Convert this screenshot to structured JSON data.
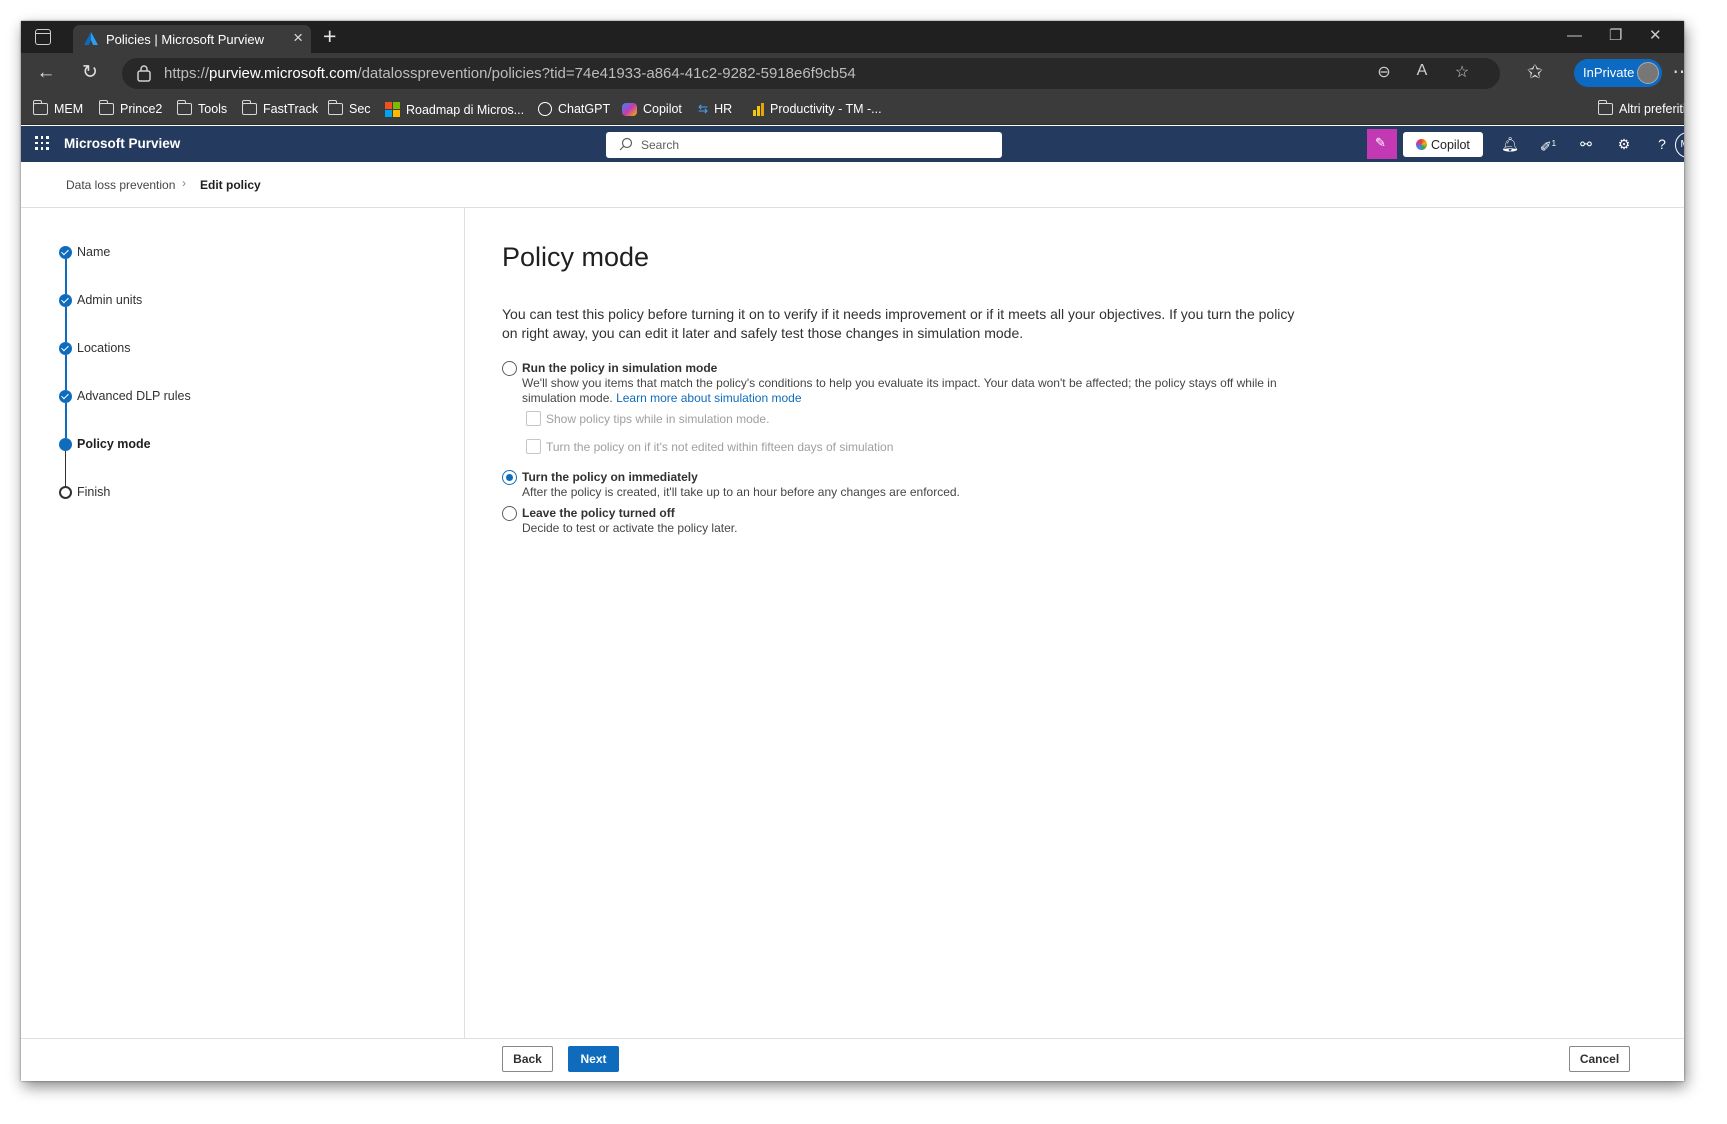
{
  "browser": {
    "tab_title": "Policies | Microsoft Purview",
    "url_prefix": "https://",
    "url_domain": "purview.microsoft.com",
    "url_path": "/datalossprevention/policies?tid=74e41933-a864-41c2-9282-5918e6f9cb54",
    "inprivate_label": "InPrivate",
    "favorites": [
      "MEM",
      "Prince2",
      "Tools",
      "FastTrack",
      "Sec",
      "Roadmap di Micros...",
      "ChatGPT",
      "Copilot",
      "HR",
      "Productivity - TM -...",
      "Altri preferiti"
    ]
  },
  "app": {
    "name": "Microsoft Purview",
    "search_placeholder": "Search",
    "copilot_label": "Copilot",
    "notification_count": "1",
    "user_initials": "MA"
  },
  "breadcrumb": {
    "parent": "Data loss prevention",
    "current": "Edit policy"
  },
  "steps": [
    {
      "label": "Name",
      "state": "done"
    },
    {
      "label": "Admin units",
      "state": "done"
    },
    {
      "label": "Locations",
      "state": "done"
    },
    {
      "label": "Advanced DLP rules",
      "state": "done"
    },
    {
      "label": "Policy mode",
      "state": "active"
    },
    {
      "label": "Finish",
      "state": "pending"
    }
  ],
  "main": {
    "title": "Policy mode",
    "description": "You can test this policy before turning it on to verify if it needs improvement or if it meets all your objectives. If you turn the policy on right away, you can edit it later and safely test those changes in simulation mode.",
    "options": {
      "simulation": {
        "title": "Run the policy in simulation mode",
        "description": "We'll show you items that match the policy's conditions to help you evaluate its impact. Your data won't be affected; the policy stays off while in simulation mode.",
        "link": "Learn more about simulation mode",
        "checked": false,
        "checkboxes": [
          {
            "label": "Show policy tips while in simulation mode.",
            "checked": false,
            "disabled": true
          },
          {
            "label": "Turn the policy on if it's not edited within fifteen days of simulation",
            "checked": false,
            "disabled": true
          }
        ]
      },
      "immediately": {
        "title": "Turn the policy on immediately",
        "description": "After the policy is created, it'll take up to an hour before any changes are enforced.",
        "checked": true
      },
      "off": {
        "title": "Leave the policy turned off",
        "description": "Decide to test or activate the policy later.",
        "checked": false
      }
    }
  },
  "footer": {
    "back_label": "Back",
    "next_label": "Next",
    "cancel_label": "Cancel"
  },
  "colors": {
    "accent": "#0f6cbd",
    "appbar": "#243a5e",
    "copilot_pink": "#c239b3"
  }
}
